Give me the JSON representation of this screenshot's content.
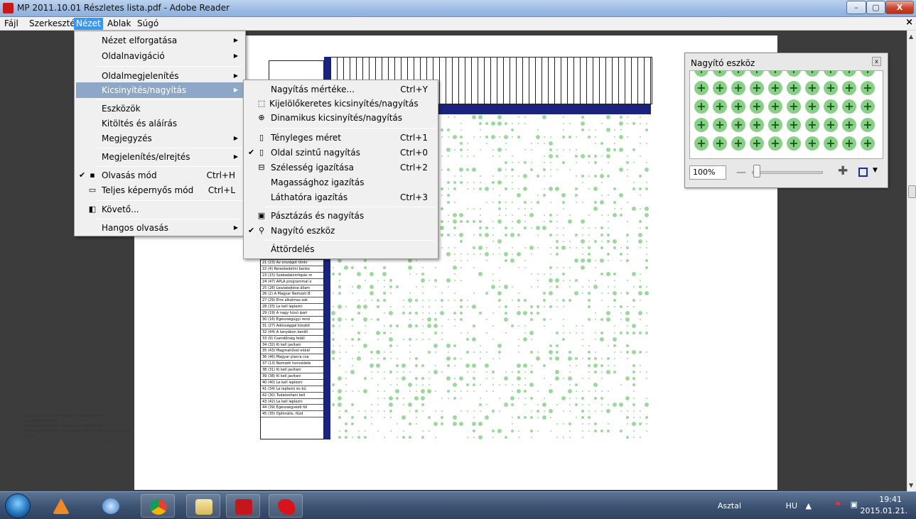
{
  "window": {
    "title": "MP 2011.10.01 Részletes lista.pdf - Adobe Reader",
    "controls": [
      "–",
      "▢",
      "X"
    ]
  },
  "menubar": {
    "items": [
      "Fájl",
      "Szerkesztés",
      "Nézet",
      "Ablak",
      "Súgó"
    ],
    "active": "Nézet",
    "close_glyph": "×"
  },
  "nezet_menu": {
    "items": [
      {
        "label": "Nézet elforgatása",
        "submenu": true
      },
      {
        "label": "Oldalnavigáció",
        "submenu": true
      },
      {
        "label": "Oldalmegjelenítés",
        "submenu": true
      },
      {
        "label": "Kicsinyítés/nagyítás",
        "submenu": true,
        "highlighted": true
      },
      {
        "label": "Eszközök"
      },
      {
        "label": "Kitöltés és aláírás"
      },
      {
        "label": "Megjegyzés",
        "submenu": true
      },
      {
        "label": "Megjelenítés/elrejtés",
        "submenu": true
      },
      {
        "label": "Olvasás mód",
        "shortcut": "Ctrl+H",
        "checked": true,
        "icon": "reading-mode-icon"
      },
      {
        "label": "Teljes képernyős mód",
        "shortcut": "Ctrl+L",
        "icon": "fullscreen-icon"
      },
      {
        "label": "Követő...",
        "icon": "tracker-icon"
      },
      {
        "label": "Hangos olvasás",
        "submenu": true
      }
    ]
  },
  "zoom_submenu": {
    "items": [
      {
        "label": "Nagyítás mértéke...",
        "shortcut": "Ctrl+Y"
      },
      {
        "label": "Kijelölőkeretes kicsinyítés/nagyítás",
        "icon": "marquee-zoom-icon"
      },
      {
        "label": "Dinamikus kicsinyítés/nagyítás",
        "icon": "dynamic-zoom-icon"
      },
      {
        "label": "Tényleges méret",
        "shortcut": "Ctrl+1",
        "icon": "actual-size-icon"
      },
      {
        "label": "Oldal szintű nagyítás",
        "shortcut": "Ctrl+0",
        "checked": true,
        "icon": "zoom-to-page-icon"
      },
      {
        "label": "Szélesség igazítása",
        "shortcut": "Ctrl+2",
        "icon": "fit-width-icon"
      },
      {
        "label": "Magassághoz igazítás"
      },
      {
        "label": "Láthatóra igazítás",
        "shortcut": "Ctrl+3"
      },
      {
        "label": "Pásztázás és nagyítás",
        "icon": "pan-zoom-icon"
      },
      {
        "label": "Nagyító eszköz",
        "checked": true,
        "icon": "loupe-icon"
      },
      {
        "label": "Áttördelés"
      }
    ]
  },
  "loupe": {
    "title": "Nagyító eszköz",
    "close": "x",
    "zoom_value": "100%",
    "zoom_fraction": 0.03
  },
  "document": {
    "row_labels": [
      "21 (23) Az országot tönkr",
      "22 (4) Kereskedelmi banko",
      "23 (15) Szabadalomlopás m",
      "24 (47) APLA programmal o",
      "25 (28) Leszakejtése állam",
      "26 (2) A Magyar Nemzeti B",
      "27 (29) Erre alkalmas sok",
      "28 (33) Le kell leplezni",
      "29 (19) A nagy húsú ipari",
      "30 (16) Egészségügyi rend",
      "31 (27) Adóssággal küszkö",
      "32 (44) A tanyákon berált",
      "33 (9) Csendőrség feláll",
      "34 (32) Ki kell javítani",
      "35 (43) Magmahővel elolál",
      "36 (46) Magyar piacra csa",
      "37 (13) Nemzeti honvédele",
      "38 (31) Ki kell javítani",
      "39 (38) Ki kell javítani",
      "40 (40) Le kell leplezni",
      "41 (34) Le leplezni és bű",
      "42 (30) Tudatosítani kell",
      "43 (42) Le kell leplezni",
      "44 (39) Egészségvédő föl",
      "45 (35) Optimális, főzd"
    ],
    "footnote": [
      "Magyar közérdekek optimalizálása. Pikavilásaival morrenó csalandosetalásikarmóe",
      "Preemocantikó stratégia megalapozása; Foltervfejlesztés",
      "APLA System. All Rights Reserved. Basic software 1998. Tajkóbarhy András, Hungary",
      "12"
    ]
  },
  "taskbar": {
    "desktop_label": "Asztal",
    "language": "HU",
    "time": "19:41",
    "date": "2015.01.21.",
    "apps": [
      "vlc-icon",
      "browser-sync-icon",
      "chrome-icon",
      "explorer-icon",
      "adobe-reader-icon",
      "paint-splat-icon"
    ]
  },
  "colors": {
    "menu_highlight": "#8fa7c7",
    "active_menu": "#3399ff",
    "doc_navy": "#1a237e",
    "dot_green": "#9bd89b"
  }
}
